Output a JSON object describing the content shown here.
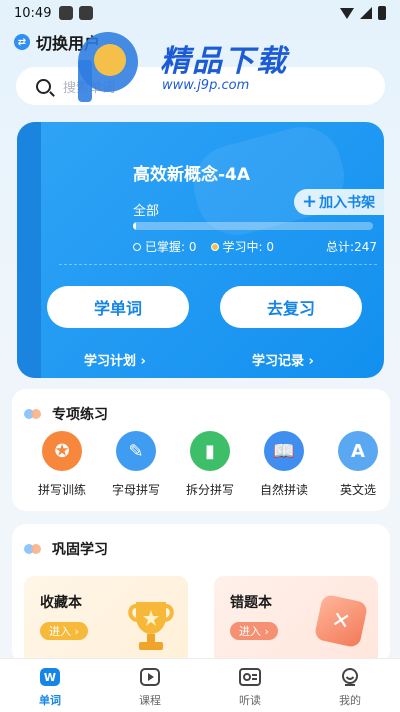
{
  "status_bar": {
    "time": "10:49"
  },
  "header": {
    "switch_user_label": "切换用户"
  },
  "watermark": {
    "title": "精品下载",
    "url": "www.j9p.com"
  },
  "search": {
    "placeholder": "搜索单词"
  },
  "book_card": {
    "title": "高效新概念-4A",
    "add_shelf_label": "加入书架",
    "scope_label": "全部",
    "progress_fraction": 0.0,
    "mastered_text": "已掌握: 0",
    "learning_text": "学习中: 0",
    "total_text": "总计:247",
    "learn_button": "学单词",
    "review_button": "去复习",
    "plan_link": "学习计划 ›",
    "record_link": "学习记录 ›"
  },
  "practice": {
    "title": "专项练习",
    "items": [
      {
        "label": "拼写训练",
        "icon": "medal-icon",
        "color": "#f6873c"
      },
      {
        "label": "字母拼写",
        "icon": "note-icon",
        "color": "#3f9cf0"
      },
      {
        "label": "拆分拼写",
        "icon": "split-book-icon",
        "color": "#3dbf69"
      },
      {
        "label": "自然拼读",
        "icon": "open-book-icon",
        "color": "#3f8ef0"
      },
      {
        "label": "英文选",
        "icon": "letter-a-icon",
        "color": "#5aa7f2"
      }
    ]
  },
  "consolidate": {
    "title": "巩固学习",
    "favorites": {
      "title": "收藏本",
      "enter": "进入 ›"
    },
    "mistakes": {
      "title": "错题本",
      "enter": "进入 ›"
    }
  },
  "nav": {
    "items": [
      {
        "label": "单词",
        "icon": "word-w-icon",
        "active": true
      },
      {
        "label": "课程",
        "icon": "play-icon",
        "active": false
      },
      {
        "label": "听读",
        "icon": "headphone-card-icon",
        "active": false
      },
      {
        "label": "我的",
        "icon": "smile-icon",
        "active": false
      }
    ]
  },
  "colors": {
    "primary": "#1685e8",
    "hero_bg": "#1e96f2"
  }
}
